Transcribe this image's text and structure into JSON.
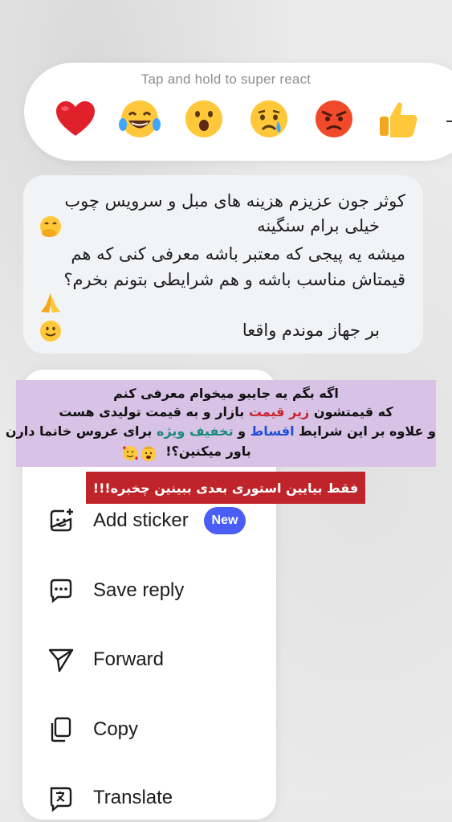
{
  "reactions": {
    "hint": "Tap and hold to super react",
    "emojis": [
      "red-heart",
      "laughing-tears",
      "surprised-face",
      "crying-face",
      "angry-face",
      "thumbs-up"
    ]
  },
  "message": {
    "line1": "کوثر جون عزیزم هزینه های مبل و سرویس چوب",
    "line2": "خیلی برام سنگینه",
    "line3": "میشه یه پیجی که معتبر باشه معرفی کنی که هم",
    "line4": "قیمتاش مناسب باشه و هم شرایطی بتونم بخرم؟",
    "line6": "بر جهاز موندم واقعا"
  },
  "menu": {
    "items": [
      {
        "label": "Add sticker",
        "icon": "sticker-add-icon"
      },
      {
        "label": "Save reply",
        "icon": "save-reply-icon"
      },
      {
        "label": "Forward",
        "icon": "forward-icon"
      },
      {
        "label": "Copy",
        "icon": "copy-icon"
      },
      {
        "label": "Translate",
        "icon": "translate-icon"
      }
    ],
    "new_badge": "New"
  },
  "story_overlay": {
    "line1": "اگه بگم یه جایبو میخوام معرفی کنم",
    "line2_a": "که قیمتشون",
    "line2_red": "زیر قیمت",
    "line2_b": "بازار و به قیمت تولیدی هست",
    "line3_a": "و علاوه بر این شرایط",
    "line3_blue": "اقساط",
    "line3_b": "و",
    "line3_teal": "تخفیف ویژه",
    "line3_c": "برای عروس خانما دارن",
    "line4": "باور میکنین؟!",
    "banner": "فقط بیایین استوری بعدی ببینین چخبره!!!"
  },
  "colors": {
    "accent_blue": "#4a5df5",
    "banner_red": "#c0242b",
    "overlay_purple": "#d8c2e6"
  }
}
